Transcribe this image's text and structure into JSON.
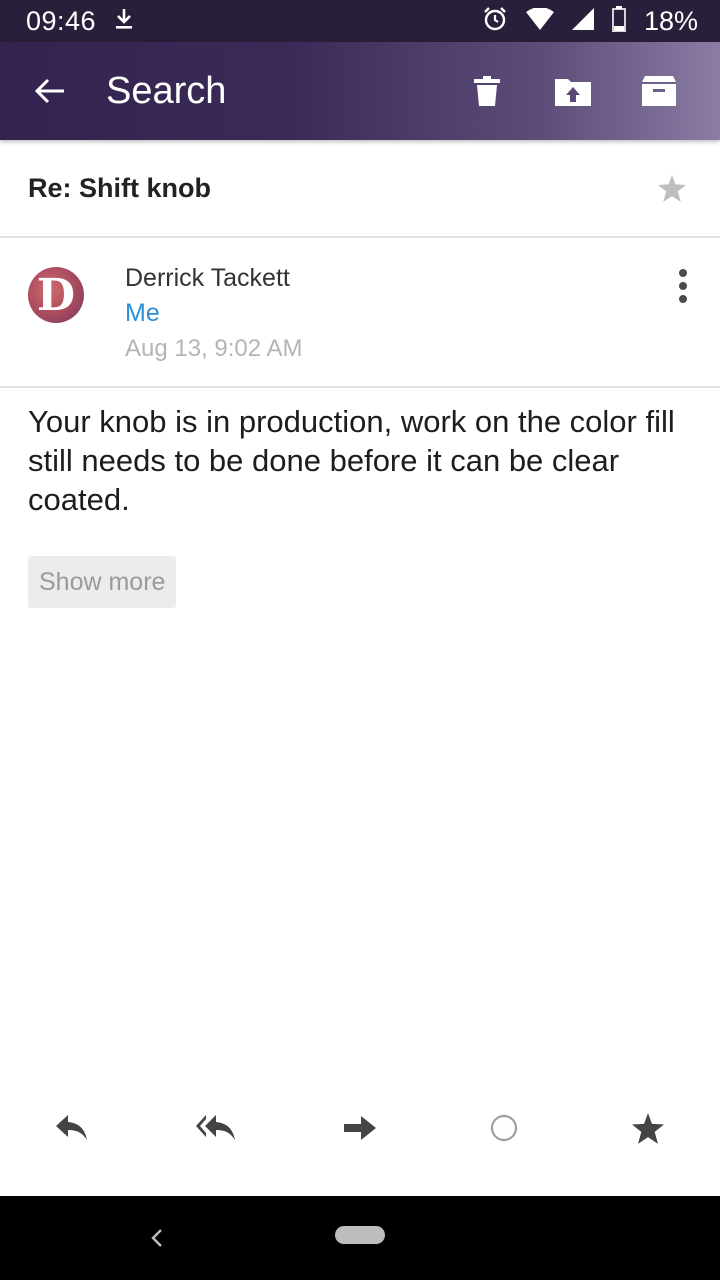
{
  "status_bar": {
    "time": "09:46",
    "battery_percent": "18%",
    "icons": [
      "download-icon",
      "alarm-icon",
      "wifi-icon",
      "signal-icon",
      "battery-icon"
    ]
  },
  "header": {
    "title": "Search",
    "background_colors": [
      "#34234f",
      "#8a7ca3"
    ],
    "actions": [
      "delete-icon",
      "move-folder-icon",
      "archive-icon"
    ]
  },
  "message": {
    "subject": "Re: Shift knob",
    "sender_name": "Derrick Tackett",
    "avatar_letter": "D",
    "to": "Me",
    "date": "Aug 13, 9:02 AM",
    "body": "Your knob is in production, work on the color fill still needs to be done before it can be clear coated.",
    "show_more_label": "Show more"
  },
  "bottom_actions": [
    "reply-icon",
    "reply-all-icon",
    "forward-icon",
    "mark-unread-icon",
    "star-icon"
  ],
  "colors": {
    "recipient_link": "#2a8fd8",
    "muted_text": "#b4b4b4"
  }
}
